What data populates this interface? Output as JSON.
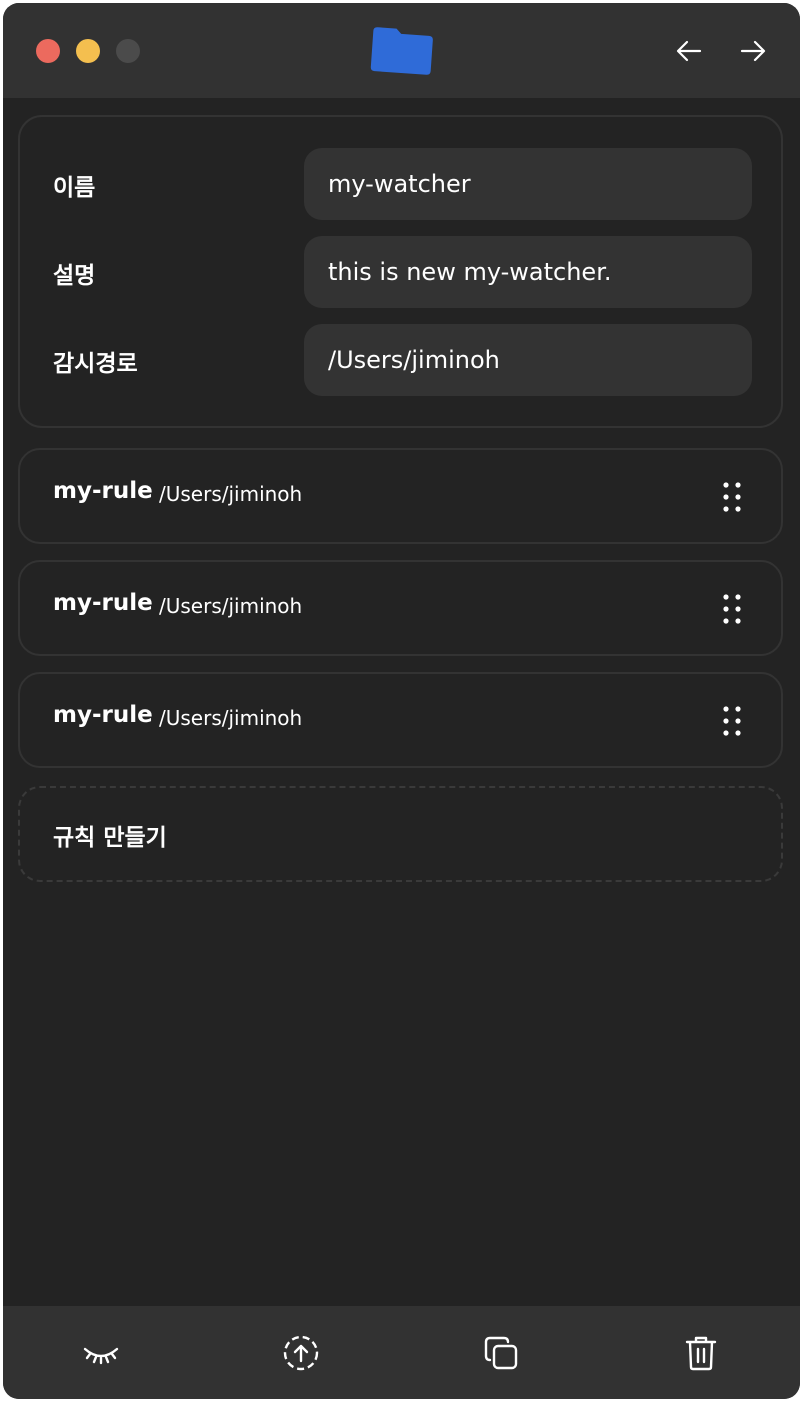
{
  "window": {
    "traffic_lights": [
      "close",
      "minimize",
      "zoom"
    ],
    "title_icon": "folder-icon",
    "nav": {
      "back_icon": "arrow-left-icon",
      "forward_icon": "arrow-right-icon"
    }
  },
  "info": {
    "name_label": "이름",
    "name_value": "my-watcher",
    "description_label": "설명",
    "description_value": "this is new my-watcher.",
    "path_label": "감시경로",
    "path_value": "/Users/jiminoh"
  },
  "rules": [
    {
      "name": "my-rule",
      "path": "/Users/jiminoh"
    },
    {
      "name": "my-rule",
      "path": "/Users/jiminoh"
    },
    {
      "name": "my-rule",
      "path": "/Users/jiminoh"
    }
  ],
  "create_rule_label": "규칙 만들기",
  "toolbar": {
    "icons": [
      "eye-closed-icon",
      "upload-icon",
      "copy-icon",
      "trash-icon"
    ]
  },
  "colors": {
    "background": "#232323",
    "bar": "#323232",
    "input": "#333333",
    "folder": "#2f6bd8",
    "close": "#ec6a5e",
    "minimize": "#f4bf4f"
  }
}
